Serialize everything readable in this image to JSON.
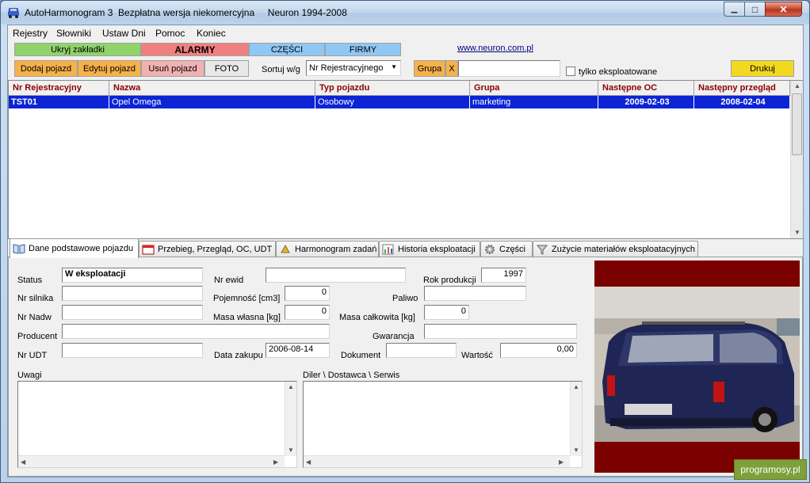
{
  "window": {
    "title": "AutoHarmonogram 3  Bezpłatna wersja niekomercyjna     Neuron 1994-2008",
    "min_glyph": "▁",
    "max_glyph": "□",
    "close_glyph": "✕"
  },
  "menu": [
    "Rejestry",
    "Słowniki",
    "Ustaw Dni",
    "Pomoc",
    "Koniec"
  ],
  "top_buttons": {
    "hide_tabs": "Ukryj zakładki",
    "alarms": "ALARMY",
    "parts": "CZĘŚCI",
    "firms": "FIRMY",
    "website": "www.neuron.com.pl"
  },
  "toolbar": {
    "add": "Dodaj pojazd",
    "edit": "Edytuj pojazd",
    "delete": "Usuń pojazd",
    "photo": "FOTO",
    "sort_label": "Sortuj w/g",
    "sort_value": "Nr Rejestracyjnego",
    "group_label": "Grupa",
    "group_clear": "X",
    "group_value": "",
    "only_operated": "tylko eksploatowane",
    "print": "Drukuj"
  },
  "colors": {
    "green": "#8fd36b",
    "red": "#f08080",
    "blue": "#8fc7f5",
    "orange": "#f6b24a",
    "pink": "#f2b1b1",
    "yellow": "#f3d820",
    "header_text": "#8b0000",
    "selection": "#0a24d6"
  },
  "grid": {
    "columns": [
      "Nr Rejestracyjny",
      "Nazwa",
      "Typ pojazdu",
      "Grupa",
      "Następne OC",
      "Następny przegląd"
    ],
    "rows": [
      [
        "TST01",
        "Opel Omega",
        "Osobowy",
        "marketing",
        "2009-02-03",
        "2008-02-04"
      ]
    ]
  },
  "tabs": [
    {
      "label": "Dane podstawowe pojazdu",
      "icon": "book-icon"
    },
    {
      "label": "Przebieg, Przegląd, OC, UDT",
      "icon": "calendar-icon"
    },
    {
      "label": "Harmonogram zadań",
      "icon": "bell-icon"
    },
    {
      "label": "Historia eksploatacji",
      "icon": "chart-icon"
    },
    {
      "label": "Części",
      "icon": "gear-icon"
    },
    {
      "label": "Zużycie materiałów eksploatacyjnych",
      "icon": "filter-icon"
    }
  ],
  "form": {
    "status_label": "Status",
    "status_value": "W eksploatacji",
    "nr_ewid_label": "Nr ewid",
    "nr_ewid_value": "",
    "rok_label": "Rok produkcji",
    "rok_value": "1997",
    "nr_silnika_label": "Nr silnika",
    "nr_silnika_value": "",
    "pojemnosc_label": "Pojemność [cm3]",
    "pojemnosc_value": "0",
    "paliwo_label": "Paliwo",
    "paliwo_value": "",
    "nr_nadw_label": "Nr Nadw",
    "nr_nadw_value": "",
    "masa_wl_label": "Masa własna [kg]",
    "masa_wl_value": "0",
    "masa_calk_label": "Masa całkowita [kg]",
    "masa_calk_value": "0",
    "producent_label": "Producent",
    "producent_value": "",
    "gwarancja_label": "Gwarancja",
    "gwarancja_value": "",
    "nr_udt_label": "Nr UDT",
    "nr_udt_value": "",
    "data_zakupu_label": "Data zakupu",
    "data_zakupu_value": "2006-08-14",
    "dokument_label": "Dokument",
    "dokument_value": "",
    "wartosc_label": "Wartość",
    "wartosc_value": "0,00",
    "uwagi_label": "Uwagi",
    "uwagi_value": "",
    "diler_label": "Diler \\ Dostawca \\ Serwis",
    "diler_value": ""
  },
  "watermark": "programosy.pl"
}
